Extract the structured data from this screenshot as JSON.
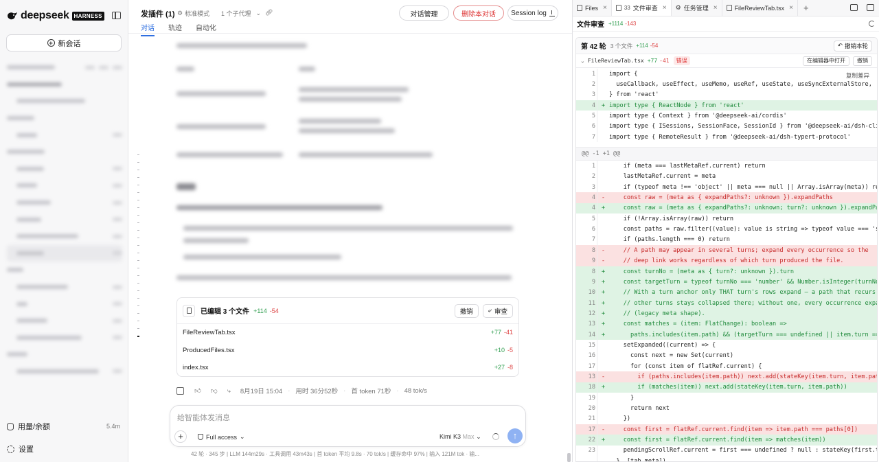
{
  "sidebar": {
    "logo_text": "deepseek",
    "logo_badge": "HARNESS",
    "new_chat_label": "新会话",
    "usage_label": "用量/余额",
    "usage_value": "5.4m",
    "settings_label": "设置"
  },
  "header": {
    "title": "发插件 (1)",
    "mode": "标准模式",
    "subagents": "1 个子代理",
    "tabs": [
      "对话",
      "轨迹",
      "自动化"
    ],
    "btn_manage": "对话管理",
    "btn_delete": "删除本对话",
    "btn_session_log": "Session log"
  },
  "edit_card": {
    "title": "已编辑 3 个文件",
    "plus": "+114",
    "minus": "-54",
    "btn_undo": "撤销",
    "btn_review": "审查",
    "files": [
      {
        "name": "FileReviewTab.tsx",
        "plus": "+77",
        "minus": "-41"
      },
      {
        "name": "ProducedFiles.tsx",
        "plus": "+10",
        "minus": "-5"
      },
      {
        "name": "index.tsx",
        "plus": "+27",
        "minus": "-8"
      }
    ]
  },
  "message_meta": {
    "date": "8月19日 15:04",
    "duration": "用时 36分52秒",
    "first_token": "首 token 71秒",
    "speed": "48 tok/s"
  },
  "composer": {
    "placeholder": "给智能体发消息",
    "access": "Full access",
    "model": "Kimi K3",
    "model_level": "Max"
  },
  "status_bar": "42 轮 · 345 步 | LLM 144m29s · 工具调用 43m43s | 首 token 平均 9.8s · 70 tok/s | 缓存命中 97% | 输入 121M tok · 输...",
  "right_panel": {
    "tabs": [
      {
        "label": "Files",
        "num": ""
      },
      {
        "label": "文件审查",
        "num": "33"
      },
      {
        "label": "任务管理",
        "num": ""
      },
      {
        "label": "FileReviewTab.tsx",
        "num": ""
      }
    ],
    "review_title": "文件审查",
    "review_plus": "+1114",
    "review_minus": "-143",
    "round_title": "第 42 轮",
    "round_files": "3 个文件",
    "round_plus": "+114",
    "round_minus": "-54",
    "undo_round": "撤销本轮",
    "file_name": "FileReviewTab.tsx",
    "file_plus": "+77",
    "file_minus": "-41",
    "error_badge": "错误",
    "open_in_editor": "在编辑器中打开",
    "file_undo": "撤销",
    "copy_diff": "复制差异",
    "hunk_header": "@@ -1 +1 @@",
    "code_block_1": [
      {
        "ln": "1",
        "mk": "",
        "t": "",
        "tx": "import {"
      },
      {
        "ln": "2",
        "mk": "",
        "t": "",
        "tx": "  useCallback, useEffect, useMemo, useRef, useState, useSyncExternalStore,"
      },
      {
        "ln": "3",
        "mk": "",
        "t": "",
        "tx": "} from 'react'"
      },
      {
        "ln": "4",
        "mk": "+",
        "t": "add",
        "tx": "import type { ReactNode } from 'react'"
      },
      {
        "ln": "5",
        "mk": "",
        "t": "",
        "tx": "import type { Context } from '@deepseek-ai/cordis'"
      },
      {
        "ln": "6",
        "mk": "",
        "t": "",
        "tx": "import type { ISessions, SessionFace, SessionId } from '@deepseek-ai/dsh-client-c"
      },
      {
        "ln": "7",
        "mk": "",
        "t": "",
        "tx": "import type { RemoteResult } from '@deepseek-ai/dsh-typert-protocol'"
      }
    ],
    "code_block_2": [
      {
        "ln": "1",
        "mk": "",
        "t": "",
        "tx": "    if (meta === lastMetaRef.current) return"
      },
      {
        "ln": "2",
        "mk": "",
        "t": "",
        "tx": "    lastMetaRef.current = meta"
      },
      {
        "ln": "3",
        "mk": "",
        "t": "",
        "tx": "    if (typeof meta !== 'object' || meta === null || Array.isArray(meta)) return"
      },
      {
        "ln": "4",
        "mk": "-",
        "t": "del",
        "tx": "    const raw = (meta as { expandPaths?: unknown }).expandPaths"
      },
      {
        "ln": "4",
        "mk": "+",
        "t": "add",
        "tx": "    const raw = (meta as { expandPaths?: unknown; turn?: unknown }).expandPaths"
      },
      {
        "ln": "5",
        "mk": "",
        "t": "",
        "tx": "    if (!Array.isArray(raw)) return"
      },
      {
        "ln": "6",
        "mk": "",
        "t": "",
        "tx": "    const paths = raw.filter((value): value is string => typeof value === 'string"
      },
      {
        "ln": "7",
        "mk": "",
        "t": "",
        "tx": "    if (paths.length === 0) return"
      },
      {
        "ln": "8",
        "mk": "-",
        "t": "del",
        "tx": "    // A path may appear in several turns; expand every occurrence so the"
      },
      {
        "ln": "9",
        "mk": "-",
        "t": "del",
        "tx": "    // deep link works regardless of which turn produced the file."
      },
      {
        "ln": "8",
        "mk": "+",
        "t": "add",
        "tx": "    const turnNo = (meta as { turn?: unknown }).turn"
      },
      {
        "ln": "9",
        "mk": "+",
        "t": "add",
        "tx": "    const targetTurn = typeof turnNo === 'number' && Number.isInteger(turnNo) ? t"
      },
      {
        "ln": "10",
        "mk": "+",
        "t": "add",
        "tx": "    // With a turn anchor only THAT turn's rows expand — a path that recurs in"
      },
      {
        "ln": "11",
        "mk": "+",
        "t": "add",
        "tx": "    // other turns stays collapsed there; without one, every occurrence expands"
      },
      {
        "ln": "12",
        "mk": "+",
        "t": "add",
        "tx": "    // (legacy meta shape)."
      },
      {
        "ln": "13",
        "mk": "+",
        "t": "add",
        "tx": "    const matches = (item: FlatChange): boolean =>"
      },
      {
        "ln": "14",
        "mk": "+",
        "t": "add",
        "tx": "      paths.includes(item.path) && (targetTurn === undefined || item.turn === tar"
      },
      {
        "ln": "15",
        "mk": "",
        "t": "",
        "tx": "    setExpanded((current) => {"
      },
      {
        "ln": "16",
        "mk": "",
        "t": "",
        "tx": "      const next = new Set(current)"
      },
      {
        "ln": "17",
        "mk": "",
        "t": "",
        "tx": "      for (const item of flatRef.current) {"
      },
      {
        "ln": "13",
        "mk": "-",
        "t": "del",
        "tx": "        if (paths.includes(item.path)) next.add(stateKey(item.turn, item.path))"
      },
      {
        "ln": "18",
        "mk": "+",
        "t": "add",
        "tx": "        if (matches(item)) next.add(stateKey(item.turn, item.path))"
      },
      {
        "ln": "19",
        "mk": "",
        "t": "",
        "tx": "      }"
      },
      {
        "ln": "20",
        "mk": "",
        "t": "",
        "tx": "      return next"
      },
      {
        "ln": "21",
        "mk": "",
        "t": "",
        "tx": "    })"
      },
      {
        "ln": "17",
        "mk": "-",
        "t": "del",
        "tx": "    const first = flatRef.current.find(item => item.path === paths[0])"
      },
      {
        "ln": "22",
        "mk": "+",
        "t": "add",
        "tx": "    const first = flatRef.current.find(item => matches(item))"
      },
      {
        "ln": "23",
        "mk": "",
        "t": "",
        "tx": "    pendingScrollRef.current = first === undefined ? null : stateKey(first.turn,"
      },
      {
        "ln": "",
        "mk": "",
        "t": "",
        "tx": "  }, [tab.meta])"
      }
    ]
  }
}
